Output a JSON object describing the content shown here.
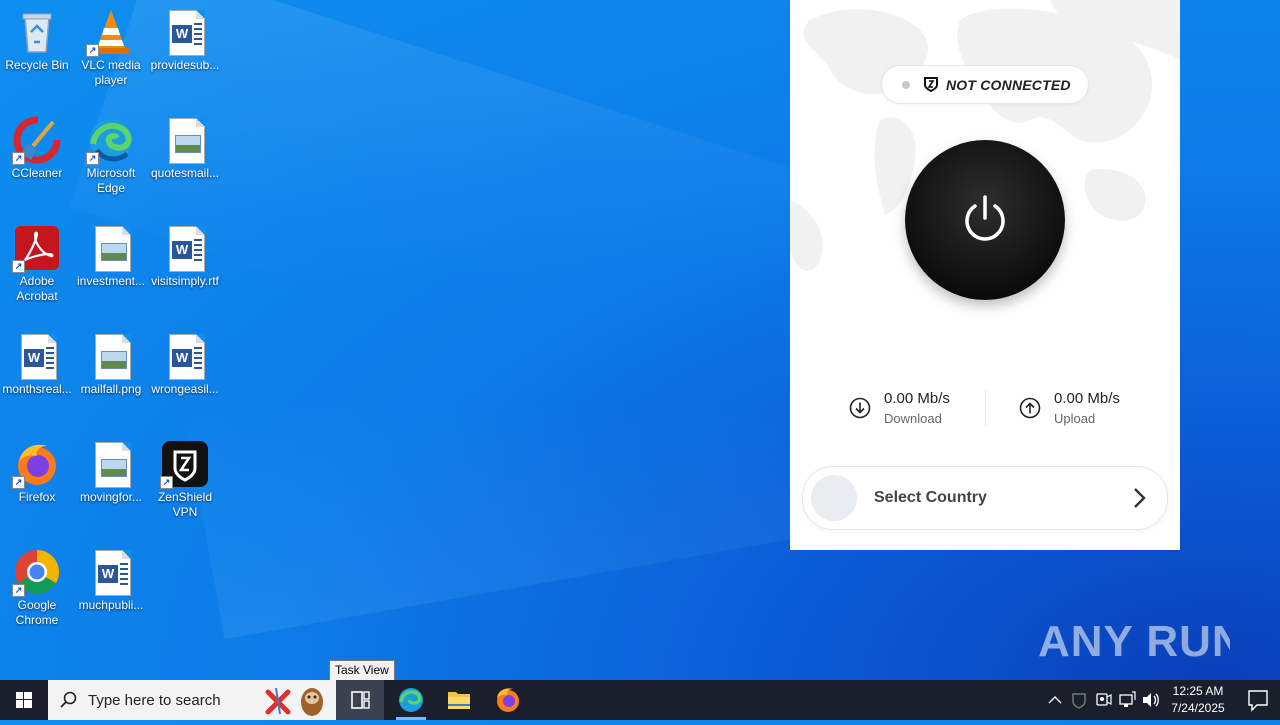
{
  "desktop": {
    "icons": [
      {
        "label": "Recycle Bin"
      },
      {
        "label": "VLC media player"
      },
      {
        "label": "providesub..."
      },
      {
        "label": "CCleaner"
      },
      {
        "label": "Microsoft Edge"
      },
      {
        "label": "quotesmail..."
      },
      {
        "label": "Adobe Acrobat"
      },
      {
        "label": "investment..."
      },
      {
        "label": "visitsimply.rtf"
      },
      {
        "label": "monthsreal..."
      },
      {
        "label": "mailfall.png"
      },
      {
        "label": "wrongeasil..."
      },
      {
        "label": "Firefox"
      },
      {
        "label": "movingfor..."
      },
      {
        "label": "ZenShield VPN"
      },
      {
        "label": "Google Chrome"
      },
      {
        "label": "muchpubli..."
      }
    ]
  },
  "vpn": {
    "status": "NOT CONNECTED",
    "download": {
      "value": "0.00 Mb/s",
      "label": "Download"
    },
    "upload": {
      "value": "0.00 Mb/s",
      "label": "Upload"
    },
    "country_button": "Select Country"
  },
  "watermark": "ANY RUN",
  "tooltip": "Task View",
  "taskbar": {
    "search_placeholder": "Type here to search",
    "time": "12:25 AM",
    "date": "7/24/2025"
  }
}
